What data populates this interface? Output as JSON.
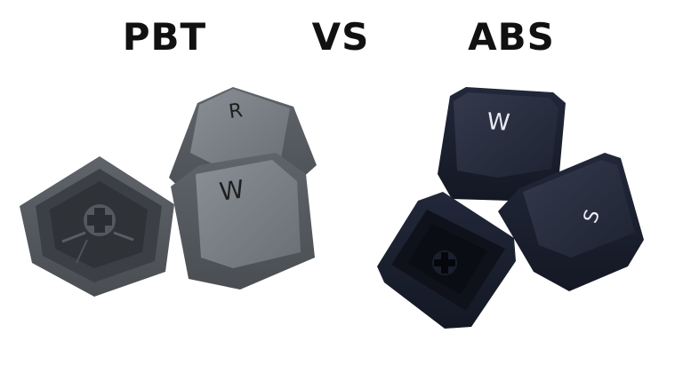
{
  "headings": {
    "left": "PBT",
    "middle": "VS",
    "right": "ABS"
  },
  "keycaps": {
    "pbt": {
      "color": "#6c7177",
      "legends": [
        "R",
        "W"
      ]
    },
    "abs": {
      "color": "#1c2130",
      "legends": [
        "W",
        "S"
      ]
    }
  },
  "colors": {
    "background": "#ffffff",
    "heading_text": "#111111",
    "pbt_legend": "#1e1e1e",
    "abs_legend": "#e9ecf2"
  }
}
